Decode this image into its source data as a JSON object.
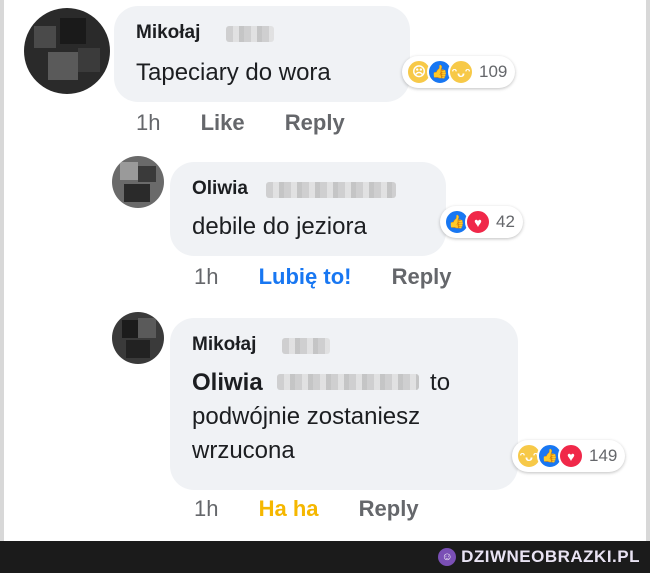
{
  "comments": [
    {
      "author": "Mikołaj",
      "text": "Tapeciary do wora",
      "reaction_icons": [
        "sad-icon",
        "like-icon",
        "haha-icon"
      ],
      "reaction_count": "109",
      "time": "1h",
      "like_label": "Like",
      "reply_label": "Reply"
    },
    {
      "author": "Oliwia",
      "text": "debile do jeziora",
      "reaction_icons": [
        "like-icon",
        "love-icon"
      ],
      "reaction_count": "42",
      "time": "1h",
      "like_label": "Lubię to!",
      "reply_label": "Reply"
    },
    {
      "author": "Mikołaj",
      "mention": "Oliwia",
      "text_after_mention": "to",
      "text_line2": "podwójnie zostaniesz",
      "text_line3": "wrzucona",
      "reaction_icons": [
        "haha-icon",
        "like-icon",
        "love-icon"
      ],
      "reaction_count": "149",
      "time": "1h",
      "like_label": "Ha ha",
      "reply_label": "Reply"
    }
  ],
  "watermark": "DZIWNEOBRAZKI.PL",
  "colors": {
    "like_blue": "#1877f2",
    "haha_yellow": "#f5b700",
    "love_red": "#f02849",
    "action_gray": "#65676b",
    "bubble_bg": "#f0f2f5"
  }
}
